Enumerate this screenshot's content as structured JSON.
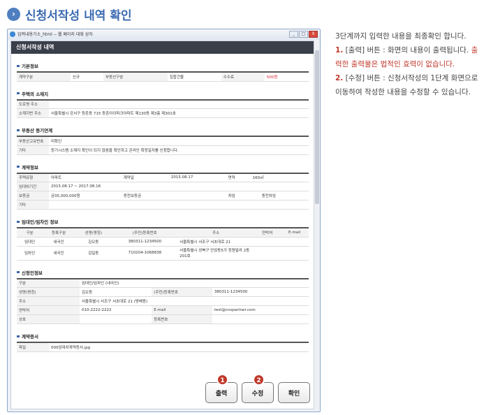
{
  "heading": {
    "title": "신청서작성 내역 확인"
  },
  "window": {
    "title": "입력내용기소_html -- 웹 페이지 대화 상자",
    "min": "_",
    "max": "□",
    "close": "X"
  },
  "popup": {
    "title": "신청서작성 내역",
    "sec_basic": "기본정보",
    "basic": {
      "l1": "계약구분",
      "v1": "신규",
      "l2": "부동산구분",
      "v2": "집합건물",
      "l3": "수수료",
      "v3": "500원"
    },
    "sec_addr": "주택의 소재지",
    "addr": {
      "l1": "도로명 주소",
      "v1": "",
      "l2": "소재지번 주소",
      "v2": "서울특별시 강서구 등촌동 715 등촌아이파크아파트 제130동 제3층 제301호"
    },
    "sec_reg": "부동산 등기연계",
    "reg": {
      "l1": "부동산고유번호",
      "v1": "미확인",
      "l2": "기타",
      "v2": "등기시스템 소재지 확인이 되지 않음을 확인하고 온라인 확정일자를 신청합니다."
    },
    "sec_contract": "계약정보",
    "contract": {
      "l_type": "주택유형",
      "v_type": "아파트",
      "l_date": "계약일",
      "v_date": "2015.08.17",
      "l_area": "면적",
      "v_area": "160㎡",
      "l_period": "임대차기간",
      "v_period": "2015.08.17 ~ 2017.08.16",
      "l_dep": "보증금",
      "v_dep": "금35,000,000원",
      "l_cdep": "증전보증금",
      "v_cdep": "",
      "l_rent": "차임",
      "v_rent": "",
      "l_crent": "종전차임",
      "v_crent": "",
      "l_etc": "기타",
      "v_etc": ""
    },
    "sec_parties": "임대인/임차인 정보",
    "parties": {
      "headers": [
        "구분",
        "등록구분",
        "성명(명칭)",
        "(주민)등록번호",
        "주소",
        "연락처",
        "E-mail"
      ],
      "rows": [
        [
          "임대인",
          "내국인",
          "김오동",
          "380311-1234500",
          "서울특별시 서조구 서초대로 21",
          "",
          ""
        ],
        [
          "임차인",
          "내국인",
          "김일동",
          "710204-1068838",
          "서울특별시 성북구 안암동5가 정원빌라 2동 201호",
          "",
          ""
        ]
      ]
    },
    "sec_applicant": "신청인정보",
    "applicant": {
      "l_kind": "구분",
      "v_kind": "임대인/임차인 (내국인)",
      "l_name": "성명(명칭)",
      "v_name": "김오동",
      "l_id": "(주민)등록번호",
      "v_id": "380311-1234500",
      "l_addr": "주소",
      "v_addr": "서울특별시 서조구 서초대로 21 (방배동)",
      "l_phone": "연락처",
      "v_phone": "010-2222-2222",
      "l_email": "E-mail",
      "v_email": "test@cnspartner.com",
      "l_trade": "상호",
      "v_trade": "",
      "l_regno": "등록번호",
      "v_regno": ""
    },
    "sec_file": "계약증서",
    "file": {
      "l": "파일",
      "v": "000임대차계약증서.jpg"
    },
    "buttons": {
      "print": "출력",
      "edit": "수정",
      "confirm": "확인",
      "n1": "1",
      "n2": "2"
    }
  },
  "desc": {
    "p1": "3단계까지 입력한 내용을 최종확인 합니다.",
    "n1": "1.",
    "t1a": " [출력] 버튼 : 화면의 내용이 출력됩니다. ",
    "t1b": "출력한 출력물은 법적인 효력이 없습니다.",
    "n2": "2.",
    "t2": " [수정] 버튼 : 신청서작성의 1단계 화면으로 이동하여 작성한 내용을 수정할 수 있습니다."
  }
}
